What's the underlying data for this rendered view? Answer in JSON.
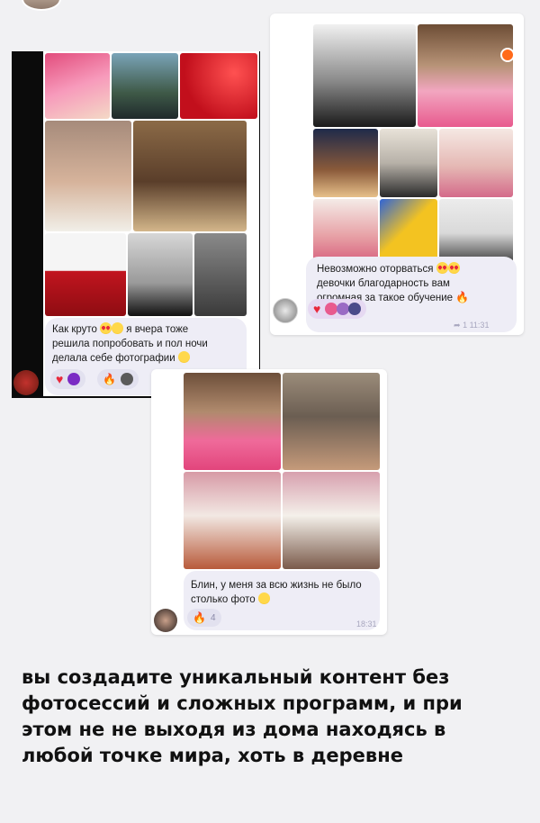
{
  "messages": [
    {
      "text_lines": [
        "Как круто",
        "решила попробовать и пол ночи",
        "делала себе фотографии"
      ],
      "reactions": [
        "heart",
        "badge",
        "fire",
        "avatar"
      ]
    },
    {
      "text_lines": [
        "Невозможно оторваться",
        "девочки благодарность вам",
        "огромная за такое обучение"
      ],
      "reactions": [
        "heart",
        "avatars"
      ],
      "meta": {
        "count": "1",
        "time": "11:31"
      }
    },
    {
      "text_lines": [
        "Блин, у меня за всю жизнь не было",
        "столько фото"
      ],
      "reaction_count": "4",
      "time": "18:31"
    }
  ],
  "caption": {
    "lines": [
      "вы создадите уникальный контент без",
      "фотосессий и сложных программ, и при",
      "этом не не выходя из дома находясь в",
      "любой точке мира, хоть в деревне"
    ]
  },
  "colors": {
    "page_bg": "#f1f1f3",
    "bubble_bg": "#eeedf6",
    "heart": "#e8283b",
    "fire": "#ff6a1a"
  }
}
